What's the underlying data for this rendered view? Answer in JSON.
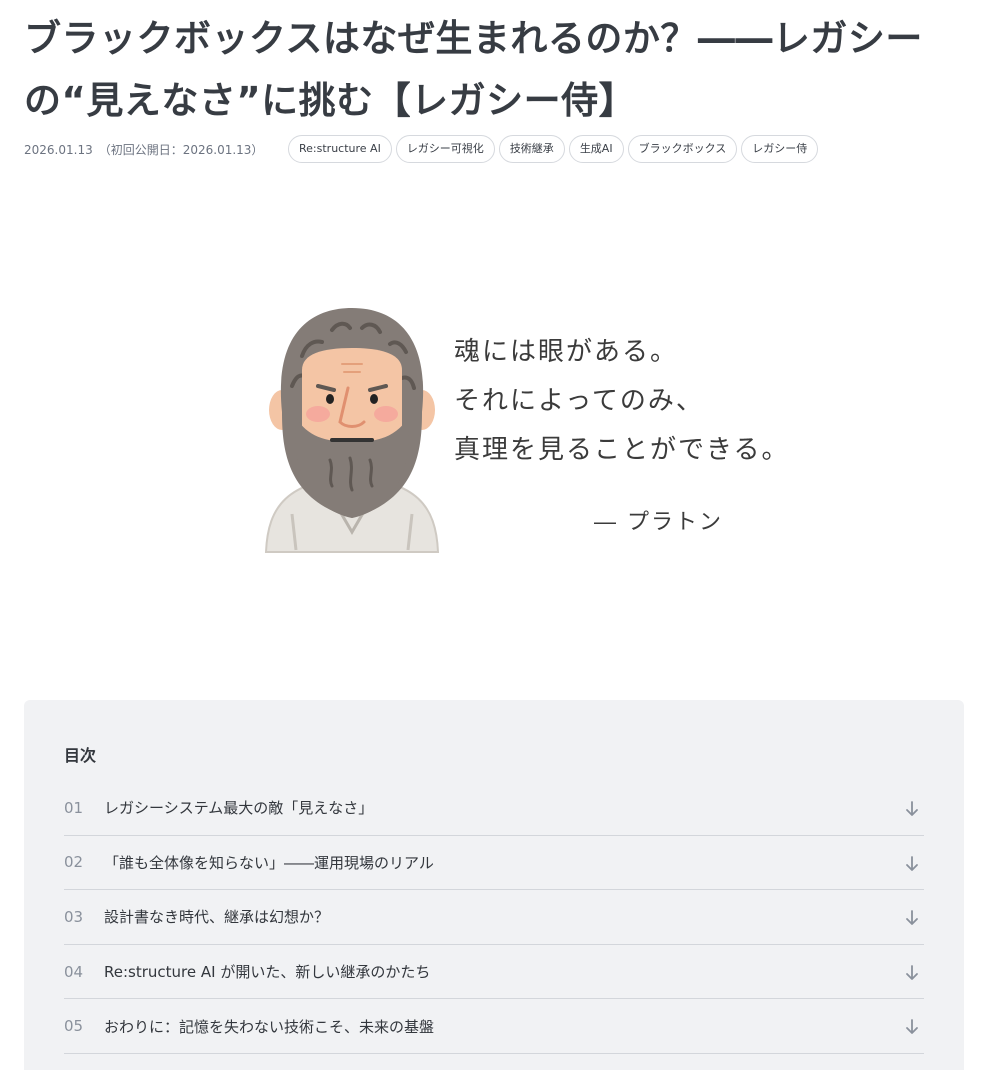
{
  "article": {
    "title_line1": "ブラックボックスはなぜ生まれるのか？――レガシー",
    "title_line2": "の“見えなさ”に挑む【レガシー侍】",
    "date": "2026.01.13",
    "first_published": "（初回公開日：2026.01.13）",
    "tags": [
      "Re:structure AI",
      "レガシー可視化",
      "技術継承",
      "生成AI",
      "ブラックボックス",
      "レガシー侍"
    ]
  },
  "hero": {
    "quote_lines": [
      "魂には眼がある。",
      "それによってのみ、",
      "真理を見ることができる。"
    ],
    "author": "― プラトン",
    "illustration": "plato-illustration"
  },
  "toc": {
    "heading": "目次",
    "items": [
      {
        "num": "01",
        "label": "レガシーシステム最大の敵「見えなさ」"
      },
      {
        "num": "02",
        "label": "「誰も全体像を知らない」――運用現場のリアル"
      },
      {
        "num": "03",
        "label": "設計書なき時代、継承は幻想か？"
      },
      {
        "num": "04",
        "label": "Re:structure AI が開いた、新しい継承のかたち"
      },
      {
        "num": "05",
        "label": "おわりに：記憶を失わない技術こそ、未来の基盤"
      }
    ],
    "arrow_icon": "arrow-down-icon"
  }
}
